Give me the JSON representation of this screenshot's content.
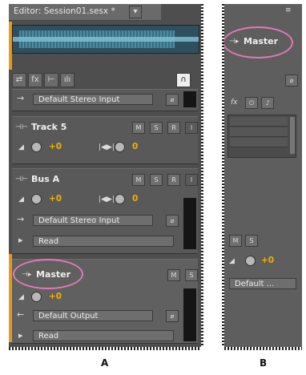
{
  "panel_a": {
    "tab_title": "Editor: Session01.sesx *",
    "tab_menu": "▾",
    "toolbar": {
      "swap": "⇄",
      "fx": "fx",
      "sends": "⊢",
      "eq": "ılı"
    },
    "input_device": "Default Stereo Input",
    "track": {
      "name": "Track 5",
      "m": "M",
      "s": "S",
      "r": "R",
      "i": "I",
      "vol": "+0",
      "pan": "0"
    },
    "bus": {
      "name": "Bus A",
      "m": "M",
      "s": "S",
      "r": "R",
      "i": "I",
      "vol": "+0",
      "pan": "0",
      "input": "Default Stereo Input",
      "automation": "Read"
    },
    "master": {
      "name": "Master",
      "m": "M",
      "s": "S",
      "vol": "+0",
      "output": "Default Output",
      "automation": "Read"
    },
    "caption": "A"
  },
  "panel_b": {
    "master_name": "Master",
    "fx": "fx",
    "m": "M",
    "s": "S",
    "vol": "+0",
    "output": "Default ...",
    "caption": "B"
  },
  "colors": {
    "accent": "#e49a1a",
    "highlight_ring": "#e079b8",
    "value": "#f0b000"
  }
}
